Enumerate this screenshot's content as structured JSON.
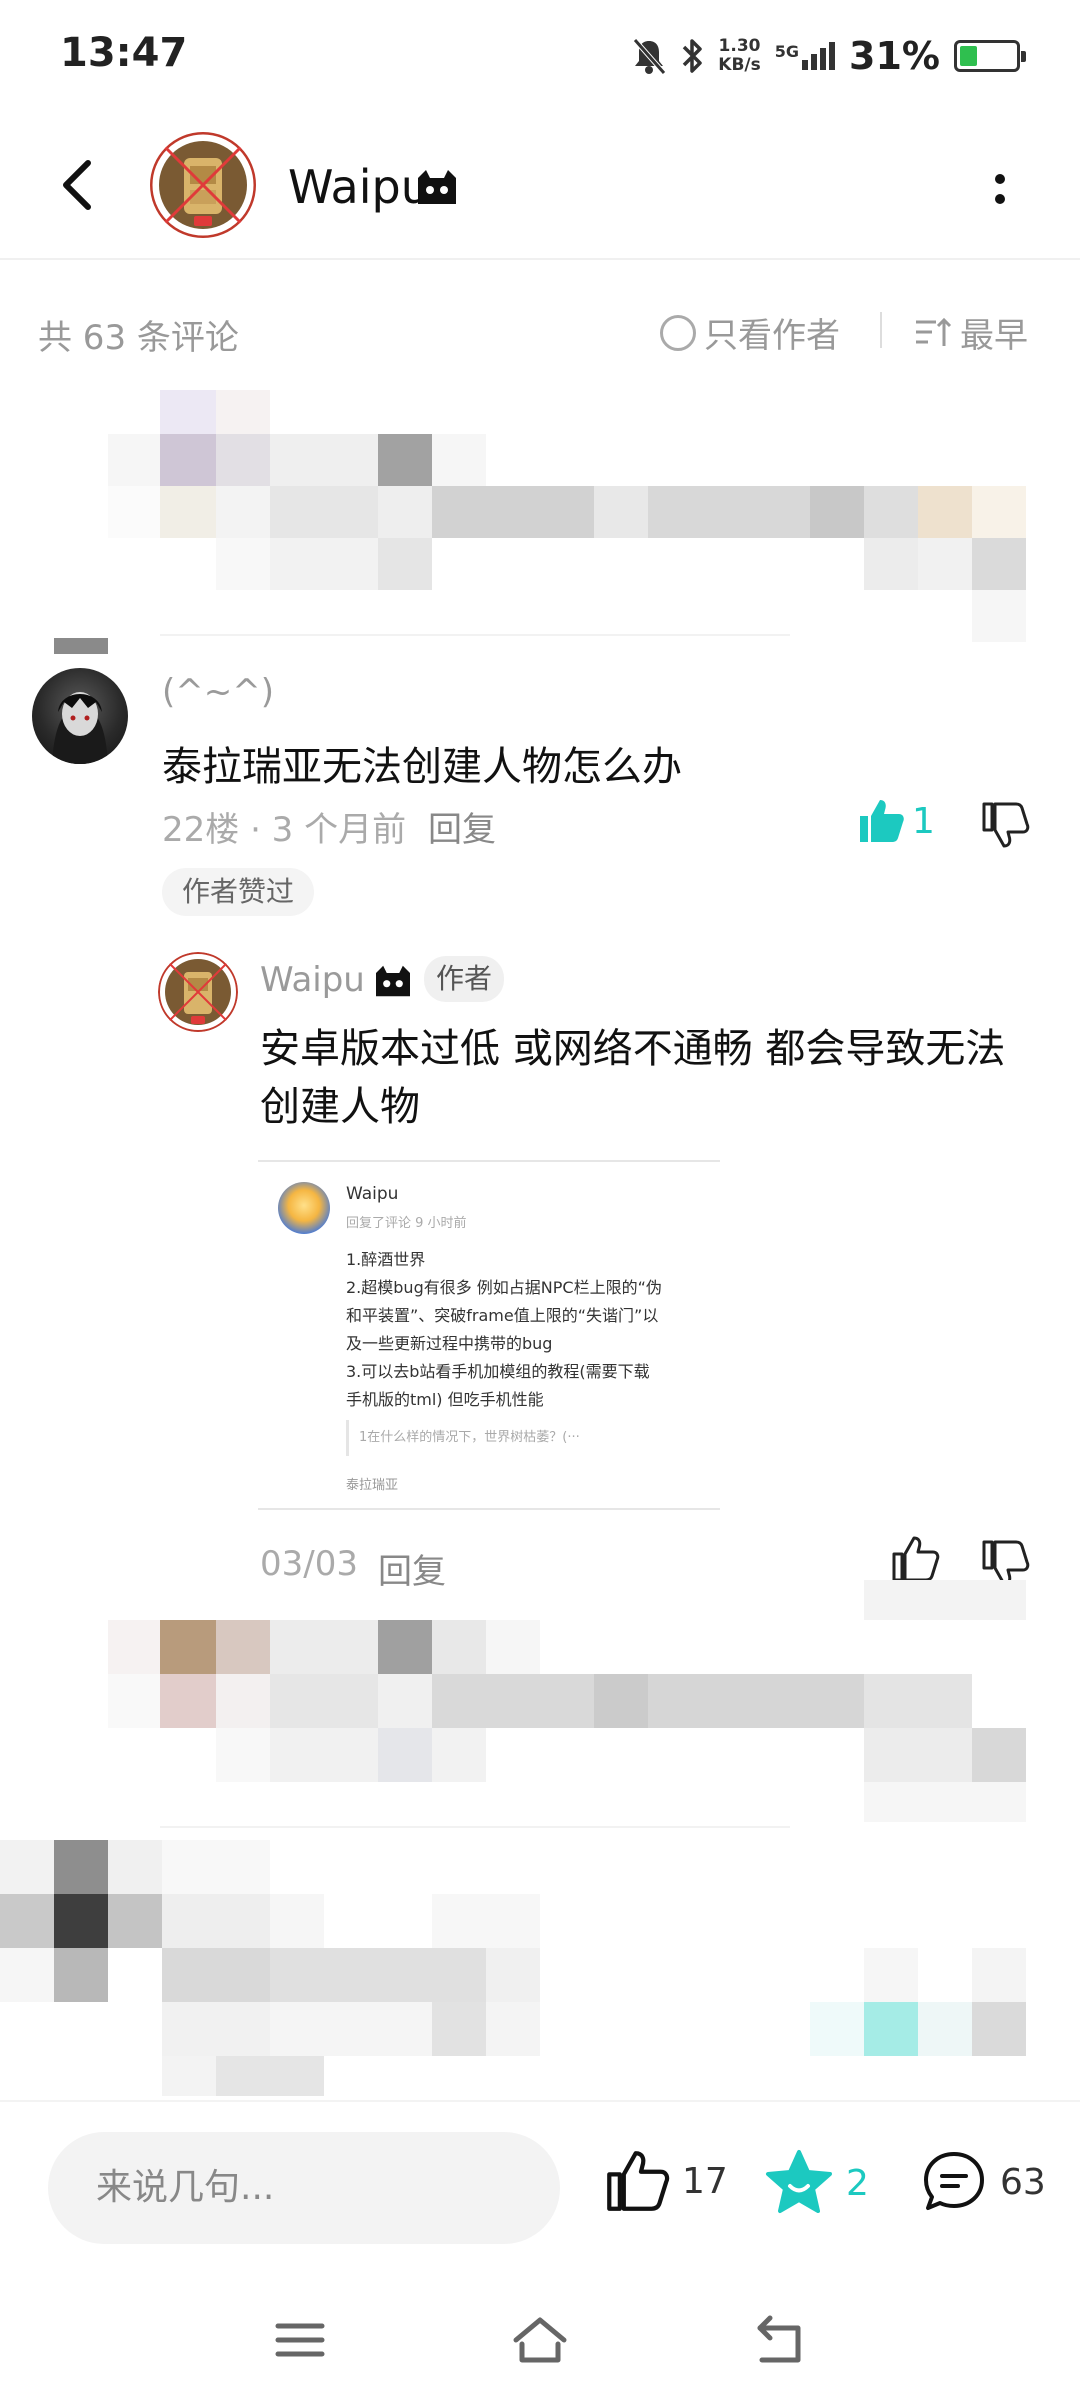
{
  "status_bar": {
    "time": "13:47",
    "speed_value": "1.30",
    "speed_unit": "KB/s",
    "network": "5G",
    "battery_percent": "31%",
    "battery_level": 0.31
  },
  "header": {
    "user_name": "Waipu",
    "back_icon": "chevron-left-icon",
    "more_icon": "more-vertical-icon"
  },
  "comments_header": {
    "count_label": "共 63 条评论",
    "author_only_label": "只看作者",
    "sort_label": "最早"
  },
  "comment": {
    "user": "(^~^)",
    "text": "泰拉瑞亚无法创建人物怎么办",
    "meta": "22楼 · 3 个月前",
    "reply_label": "回复",
    "like_count": "1",
    "liked_tag": "作者赞过"
  },
  "reply": {
    "user": "Waipu",
    "author_tag": "作者",
    "text": "安卓版本过低 或网络不通畅 都会导致无法创建人物",
    "date": "03/03",
    "reply_label": "回复",
    "embed": {
      "user": "Waipu",
      "subtitle": "回复了评论 9 小时前",
      "lines": [
        "1.醉酒世界",
        "2.超模bug有很多 例如占据NPC栏上限的“伪",
        "和平装置”、突破frame值上限的“失谐门”以",
        "及一些更新过程中携带的bug",
        "3.可以去b站看手机加模组的教程(需要下载",
        "手机版的tml) 但吃手机性能"
      ],
      "quote": "1在什么样的情况下，世界树枯萎？(···",
      "tag": "泰拉瑞亚"
    }
  },
  "bottom_bar": {
    "input_placeholder": "来说几句...",
    "like_count": "17",
    "favorite_count": "2",
    "comment_count": "63"
  },
  "colors": {
    "accent": "#1cc9c0",
    "muted_text": "#999999",
    "text": "#111111"
  }
}
